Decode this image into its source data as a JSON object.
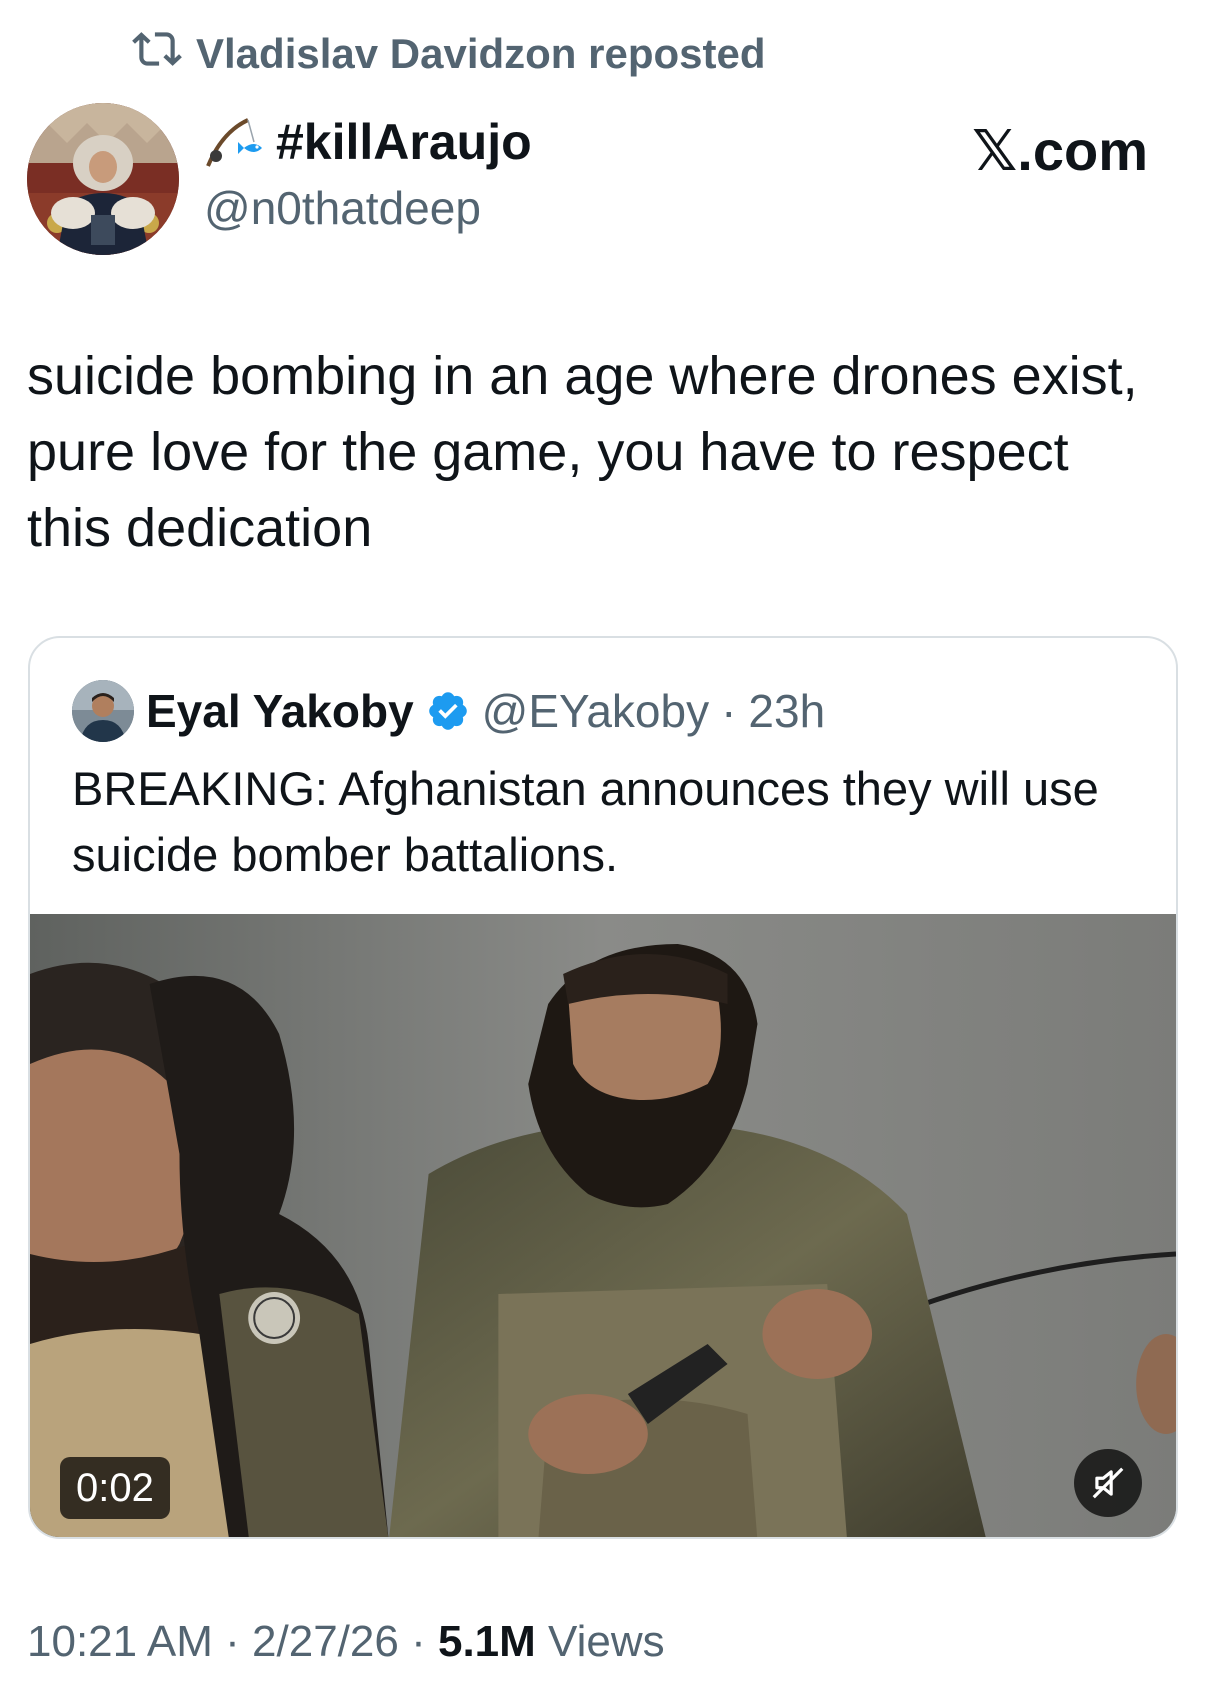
{
  "repost": {
    "label": "Vladislav Davidzon reposted",
    "icon": "repost-icon"
  },
  "author": {
    "display_name": "#killAraujo",
    "name_icon": "fishing-rod-emoji",
    "handle": "@n0thatdeep"
  },
  "brand": "𝕏.com",
  "tweet": {
    "text": "suicide bombing in an age where drones exist, pure love for the game, you have to respect this dedication"
  },
  "quoted": {
    "display_name": "Eyal Yakoby",
    "verified_icon": "verified-badge-icon",
    "handle": "@EYakoby",
    "separator": "·",
    "age": "23h",
    "text": "BREAKING: Afghanistan announces they will use suicide bomber battalions.",
    "video": {
      "duration": "0:02",
      "mute_icon": "volume-muted-icon"
    }
  },
  "footer": {
    "time": "10:21 AM",
    "sep1": "·",
    "date": "2/27/26",
    "sep2": "·",
    "views_count": "5.1M",
    "views_label": "Views"
  },
  "colors": {
    "text": "#0f1419",
    "secondary": "#536471",
    "border": "#d9dfe3",
    "verified": "#1d9bf0"
  }
}
